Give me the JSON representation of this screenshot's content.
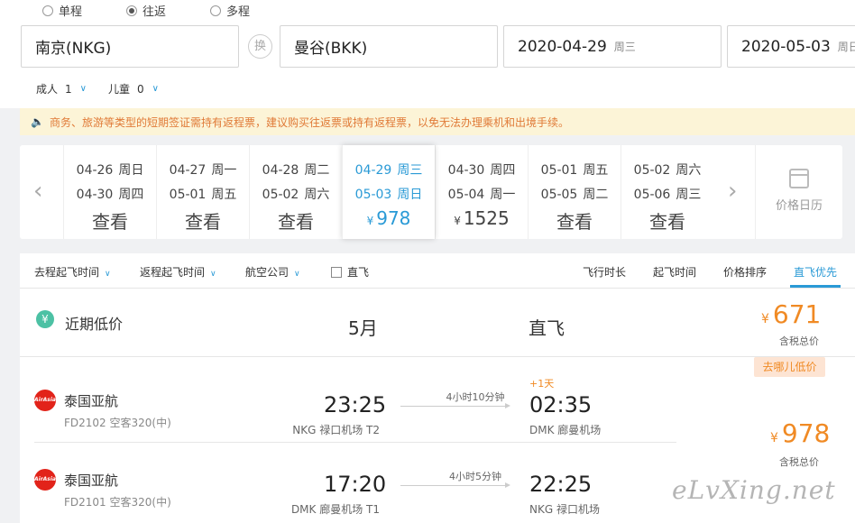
{
  "trip_types": [
    {
      "label": "单程",
      "selected": false
    },
    {
      "label": "往返",
      "selected": true
    },
    {
      "label": "多程",
      "selected": false
    }
  ],
  "search": {
    "from": "南京(NKG)",
    "swap_label": "换",
    "to": "曼谷(BKK)",
    "depart_date": "2020-04-29",
    "depart_weekday": "周三",
    "return_date": "2020-05-03",
    "return_weekday": "周日"
  },
  "passengers": {
    "adult_label": "成人",
    "adult_count": "1",
    "child_label": "儿童",
    "child_count": "0"
  },
  "notice": "商务、旅游等类型的短期签证需持有返程票，建议购买往返票或持有返程票，以免无法办理乘机和出境手续。",
  "date_options": [
    {
      "depart": "04-26",
      "depart_wk": "周日",
      "return": "04-30",
      "return_wk": "周四",
      "action": "查看",
      "price": null,
      "selected": false
    },
    {
      "depart": "04-27",
      "depart_wk": "周一",
      "return": "05-01",
      "return_wk": "周五",
      "action": "查看",
      "price": null,
      "selected": false
    },
    {
      "depart": "04-28",
      "depart_wk": "周二",
      "return": "05-02",
      "return_wk": "周六",
      "action": "查看",
      "price": null,
      "selected": false
    },
    {
      "depart": "04-29",
      "depart_wk": "周三",
      "return": "05-03",
      "return_wk": "周日",
      "action": "",
      "price": "978",
      "selected": true
    },
    {
      "depart": "04-30",
      "depart_wk": "周四",
      "return": "05-04",
      "return_wk": "周一",
      "action": "",
      "price": "1525",
      "selected": false
    },
    {
      "depart": "05-01",
      "depart_wk": "周五",
      "return": "05-05",
      "return_wk": "周二",
      "action": "查看",
      "price": null,
      "selected": false
    },
    {
      "depart": "05-02",
      "depart_wk": "周六",
      "return": "05-06",
      "return_wk": "周三",
      "action": "查看",
      "price": null,
      "selected": false
    }
  ],
  "currency_symbol": "¥",
  "calendar_label": "价格日历",
  "filters": {
    "depart_time": "去程起飞时间",
    "return_time": "返程起飞时间",
    "airline": "航空公司",
    "direct": "直飞"
  },
  "sorts": {
    "duration": "飞行时长",
    "takeoff": "起飞时间",
    "price": "价格排序",
    "direct_first": "直飞优先"
  },
  "low_price": {
    "label": "近期低价",
    "month": "5月",
    "type": "直飞",
    "price": "671",
    "tax_note": "含税总价",
    "badge": "去哪儿低价"
  },
  "outbound": {
    "airline": "泰国亚航",
    "logo_text": "AirAsia",
    "flight": "FD2102 空客320(中)",
    "dep_time": "23:25",
    "dep_airport": "NKG 禄口机场 T2",
    "duration": "4小时10分钟",
    "plus_day": "+1天",
    "arr_time": "02:35",
    "arr_airport": "DMK 廊曼机场"
  },
  "inbound": {
    "airline": "泰国亚航",
    "logo_text": "AirAsia",
    "flight": "FD2101 空客320(中)",
    "dep_time": "17:20",
    "dep_airport": "DMK 廊曼机场 T1",
    "duration": "4小时5分钟",
    "arr_time": "22:25",
    "arr_airport": "NKG 禄口机场"
  },
  "roundtrip_price": "978",
  "roundtrip_tax_note": "含税总价",
  "watermark": "eLvXing.net"
}
